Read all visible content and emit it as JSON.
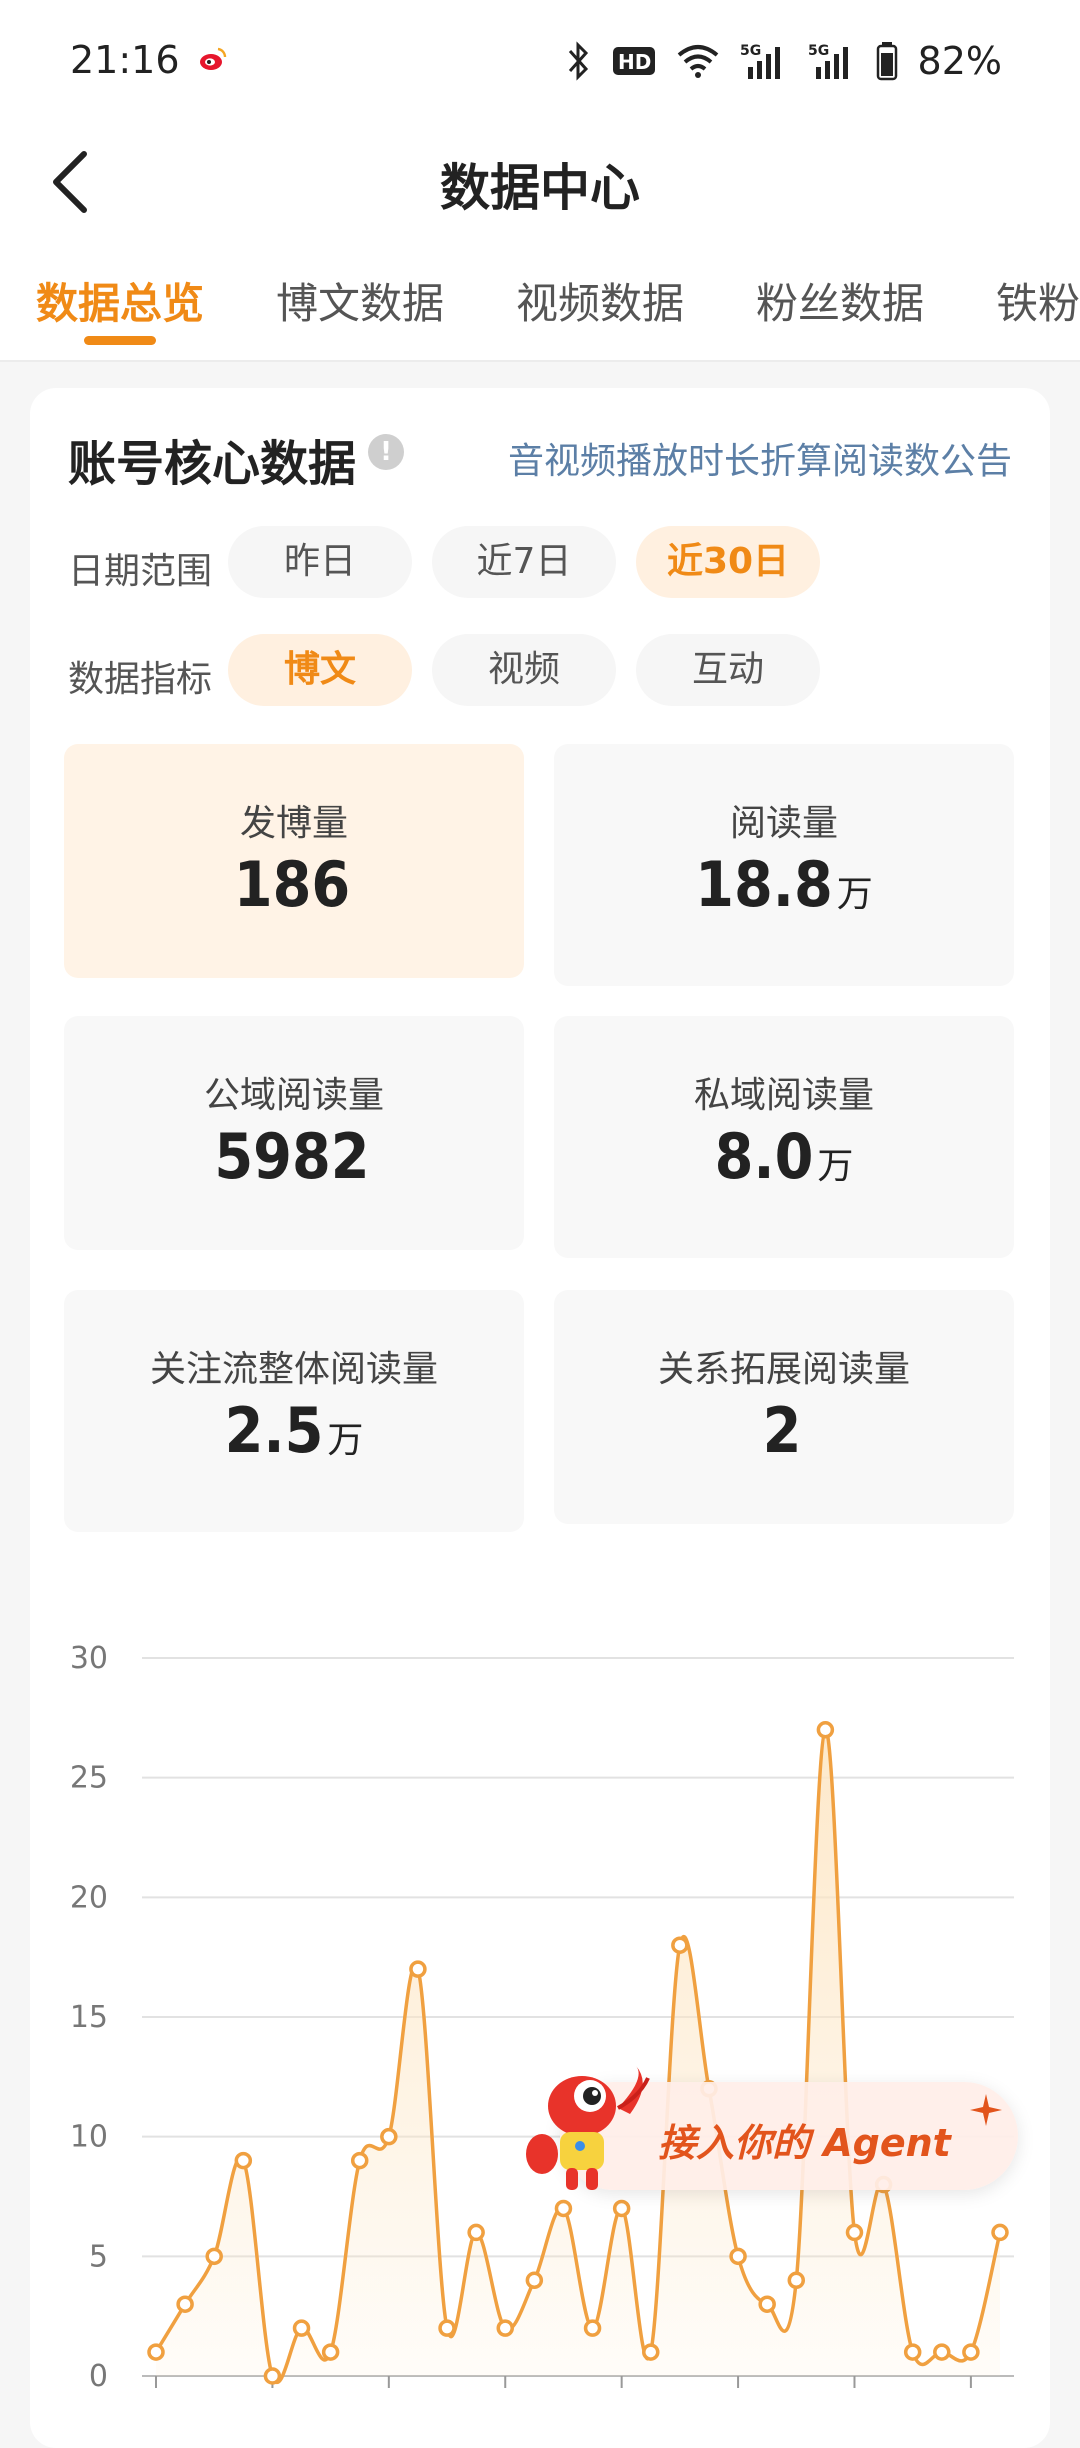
{
  "status_bar": {
    "time": "21:16",
    "battery": "82%",
    "signal_label": "5G",
    "hd_label": "HD"
  },
  "nav": {
    "title": "数据中心"
  },
  "tabs": [
    {
      "label": "数据总览",
      "active": true
    },
    {
      "label": "博文数据",
      "active": false
    },
    {
      "label": "视频数据",
      "active": false
    },
    {
      "label": "粉丝数据",
      "active": false
    },
    {
      "label": "铁粉",
      "active": false
    }
  ],
  "card": {
    "title": "账号核心数据",
    "info_icon": "!",
    "notice_link": "音视频播放时长折算阅读数公告",
    "date_range": {
      "label": "日期范围",
      "options": [
        "昨日",
        "近7日",
        "近30日"
      ],
      "selected": "近30日"
    },
    "metric": {
      "label": "数据指标",
      "options": [
        "博文",
        "视频",
        "互动"
      ],
      "selected": "博文"
    },
    "stats": [
      {
        "label": "发博量",
        "value": "186",
        "unit": "",
        "highlight": true
      },
      {
        "label": "阅读量",
        "value": "18.8",
        "unit": "万",
        "highlight": false
      },
      {
        "label": "公域阅读量",
        "value": "5982",
        "unit": "",
        "highlight": false
      },
      {
        "label": "私域阅读量",
        "value": "8.0",
        "unit": "万",
        "highlight": false
      },
      {
        "label": "关注流整体阅读量",
        "value": "2.5",
        "unit": "万",
        "highlight": false
      },
      {
        "label": "关系拓展阅读量",
        "value": "2",
        "unit": "",
        "highlight": false
      }
    ]
  },
  "chart_data": {
    "type": "area",
    "ylim": [
      0,
      30
    ],
    "yticks": [
      0,
      5,
      10,
      15,
      20,
      25,
      30
    ],
    "values": [
      1,
      3,
      5,
      9,
      0,
      2,
      1,
      9,
      10,
      17,
      2,
      6,
      2,
      4,
      7,
      2,
      7,
      1,
      18,
      12,
      5,
      3,
      4,
      27,
      6,
      8,
      1,
      1,
      1,
      6
    ],
    "grid": true,
    "line_color": "#f0a040",
    "fill_color": "#fde6c4"
  },
  "agent_button": {
    "label": "接入你的 Agent"
  }
}
